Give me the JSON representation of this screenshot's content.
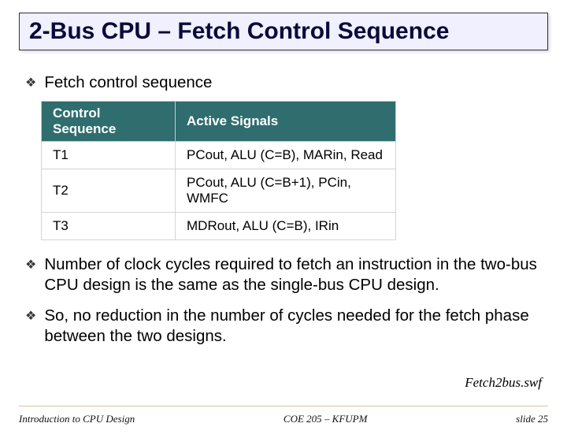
{
  "title": "2-Bus CPU – Fetch Control Sequence",
  "bullets": {
    "b0": "Fetch control sequence",
    "b1": "Number of clock cycles required to fetch an instruction in the two-bus CPU design is the same as the single-bus CPU design.",
    "b2": "So, no reduction in the number of cycles needed for the fetch phase between the two designs."
  },
  "table": {
    "headers": {
      "h0": "Control Sequence",
      "h1": "Active Signals"
    },
    "rows": {
      "r0": {
        "step": "T1",
        "signals": "PCout, ALU (C=B), MARin, Read"
      },
      "r1": {
        "step": "T2",
        "signals": "PCout, ALU (C=B+1), PCin, WMFC"
      },
      "r2": {
        "step": "T3",
        "signals": "MDRout, ALU (C=B), IRin"
      }
    }
  },
  "swf_label": "Fetch2bus.swf",
  "footer": {
    "left": "Introduction to CPU Design",
    "center": "COE 205 – KFUPM",
    "right": "slide 25"
  },
  "bullet_glyph": "❖"
}
